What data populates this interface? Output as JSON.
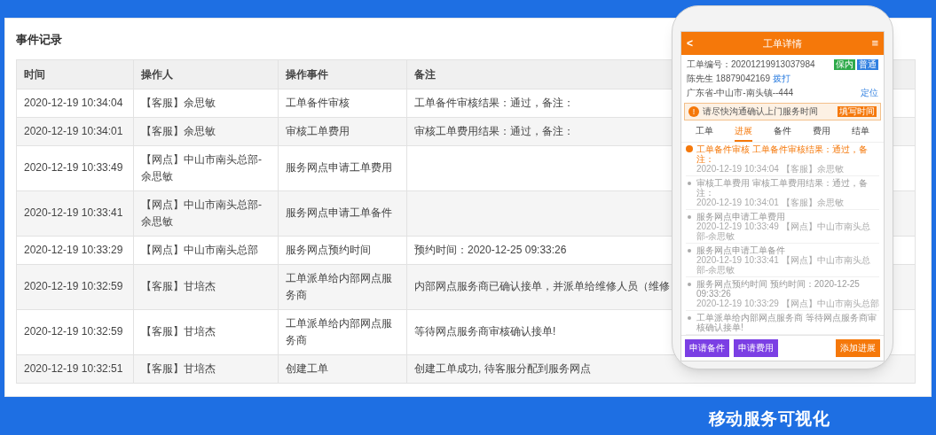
{
  "section_title": "事件记录",
  "table": {
    "columns": [
      "时间",
      "操作人",
      "操作事件",
      "备注"
    ],
    "rows": [
      {
        "cells": [
          "2020-12-19 10:34:04",
          "【客服】余思敏",
          "工单备件审核",
          "工单备件审核结果：通过，备注："
        ]
      },
      {
        "cells": [
          "2020-12-19 10:34:01",
          "【客服】余思敏",
          "审核工单费用",
          "审核工单费用结果：通过，备注："
        ]
      },
      {
        "cells": [
          "2020-12-19 10:33:49",
          "【网点】中山市南头总部-余思敏",
          "服务网点申请工单费用",
          ""
        ]
      },
      {
        "cells": [
          "2020-12-19 10:33:41",
          "【网点】中山市南头总部-余思敏",
          "服务网点申请工单备件",
          ""
        ]
      },
      {
        "cells": [
          "2020-12-19 10:33:29",
          "【网点】中山市南头总部",
          "服务网点预约时间",
          "预约时间：2020-12-25 09:33:26"
        ]
      },
      {
        "cells": [
          "2020-12-19 10:32:59",
          "【客服】甘培杰",
          "工单派单给内部网点服务商",
          "内部网点服务商已确认接单，并派单给维修人员（维修"
        ]
      },
      {
        "cells": [
          "2020-12-19 10:32:59",
          "【客服】甘培杰",
          "工单派单给内部网点服务商",
          "等待网点服务商审核确认接单!"
        ]
      },
      {
        "cells": [
          "2020-12-19 10:32:51",
          "【客服】甘培杰",
          "创建工单",
          "创建工单成功, 待客服分配到服务网点"
        ]
      }
    ]
  },
  "phone": {
    "header": {
      "back": "<",
      "title": "工单详情",
      "menu": "≡"
    },
    "order_no": "工单编号：20201219913037984",
    "tags": [
      {
        "text": "保内",
        "color": "#2eaa4a"
      },
      {
        "text": "普通",
        "color": "#2f7fe0"
      }
    ],
    "contact": "陈先生  18879042169",
    "call_link": "拨打",
    "address": "广东省-中山市-南头镇--444",
    "locate_link": "定位",
    "notice": {
      "icon": "!",
      "text": "请尽快沟通确认上门服务时间",
      "button": "填写时间"
    },
    "tabs": [
      {
        "label": "工单",
        "selected": false
      },
      {
        "label": "进展",
        "selected": true
      },
      {
        "label": "备件",
        "selected": false
      },
      {
        "label": "费用",
        "selected": false
      },
      {
        "label": "结单",
        "selected": false
      }
    ],
    "timeline": [
      {
        "title": "工单备件审核  工单备件审核结果：通过，备注：",
        "meta": "2020-12-19 10:34:04  【客服】余思敏",
        "selected": true
      },
      {
        "title": "审核工单费用  审核工单费用结果：通过，备注：",
        "meta": "2020-12-19 10:34:01  【客服】余思敏",
        "selected": false
      },
      {
        "title": "服务网点申请工单费用",
        "meta": "2020-12-19 10:33:49  【网点】中山市南头总部-余思敏",
        "selected": false
      },
      {
        "title": "服务网点申请工单备件",
        "meta": "2020-12-19 10:33:41  【网点】中山市南头总部-余思敏",
        "selected": false
      },
      {
        "title": "服务网点预约时间  预约时间：2020-12-25 09:33:26",
        "meta": "2020-12-19 10:33:29  【网点】中山市南头总部",
        "selected": false
      },
      {
        "title": "工单派单给内部网点服务商  等待网点服务商审核确认接单!",
        "selected": false
      }
    ],
    "buttons": [
      {
        "label": "申请备件",
        "kind": "purple"
      },
      {
        "label": "申请费用",
        "kind": "purple"
      },
      {
        "label": "添加进展",
        "kind": "orange"
      }
    ]
  },
  "caption": "移动服务可视化"
}
